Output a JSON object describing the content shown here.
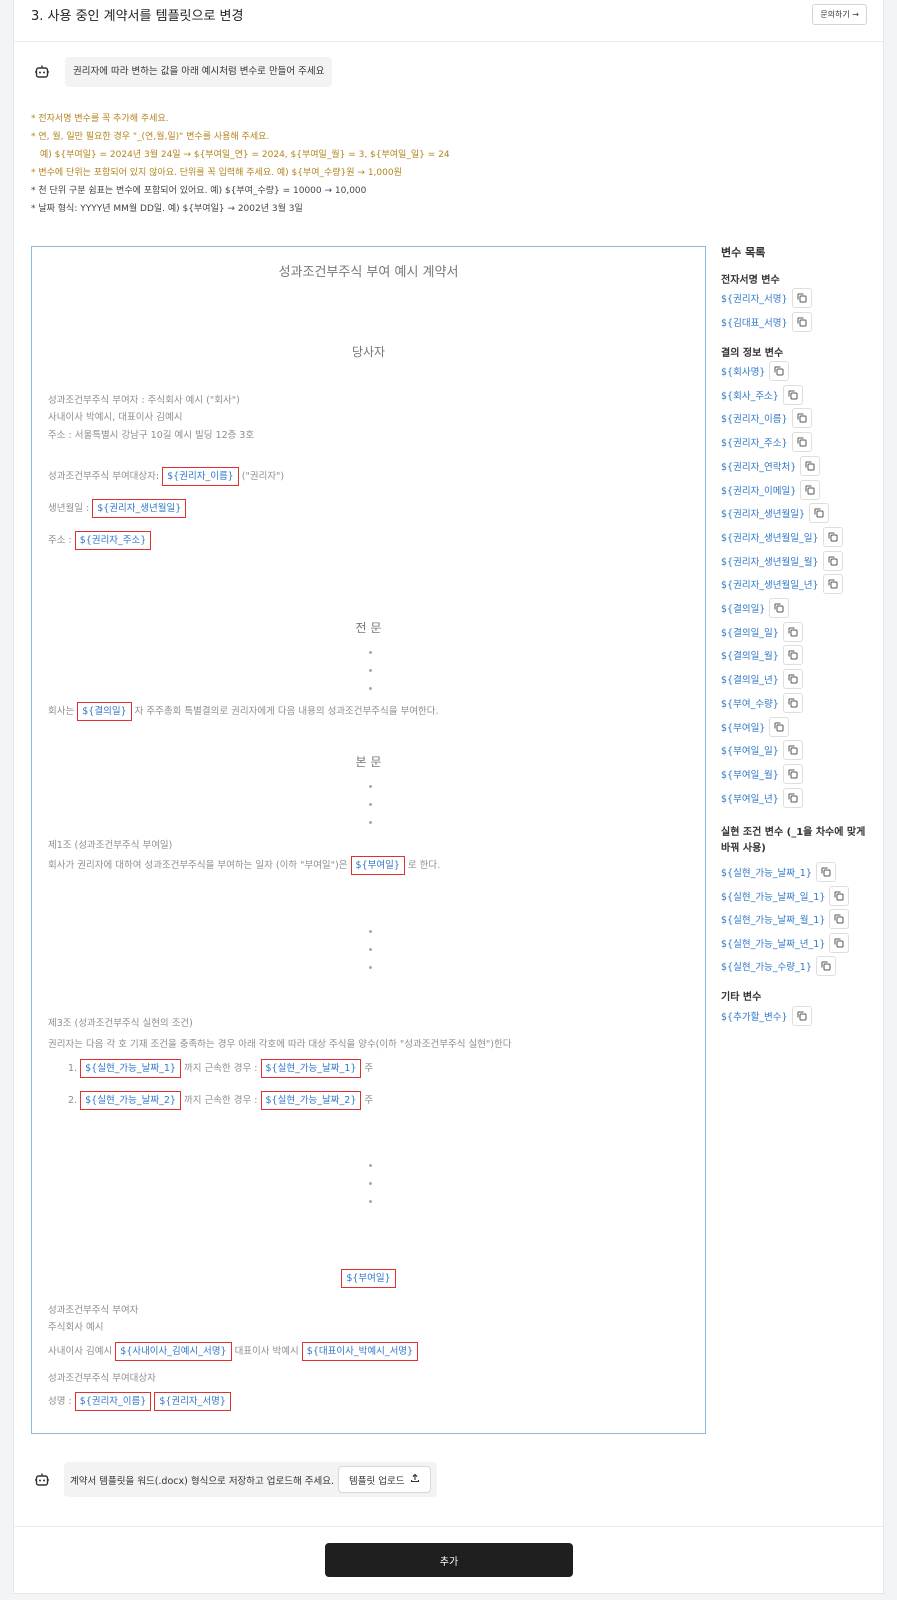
{
  "header": {
    "title": "3. 사용 중인 계약서를 템플릿으로 변경",
    "inquiry_label": "문의하기 →"
  },
  "instruction": {
    "text": "권리자에 따라 변하는 값을 아래 예시처럼 변수로 만들어 주세요"
  },
  "notes": [
    "* 전자서명 변수를 꼭 추가해 주세요.",
    "* 연, 월, 일만 필요한 경우 \"_(연,월,일)\" 변수를 사용해 주세요.",
    "예) ${부여일} = 2024년 3월 24일 → ${부여일_연} = 2024, ${부여일_월} = 3, ${부여일_일} = 24",
    "* 변수에 단위는 포함되어 있지 않아요. 단위를 꼭 입력해 주세요. 예) ${부여_수량}원 → 1,000원",
    "* 천 단위 구분 쉼표는 변수에 포함되어 있어요. 예) ${부여_수량} = 10000 → 10,000",
    "* 날짜 형식: YYYY년 MM월 DD일. 예) ${부여일} → 2002년 3월 3일"
  ],
  "doc": {
    "title": "성과조건부주식 부여 예시 계약서",
    "parties_heading": "당사자",
    "grantor_line": "성과조건부주식 부여자 : 주식회사 예시 (\"회사\")",
    "directors_line": "사내이사 박예시, 대표이사 김예시",
    "address_line": "주소 : 서울특별시 강남구 10길 예시 빌딩 12층 3호",
    "grantee_label": "성과조건부주식 부여대상자:",
    "grantee_var": "${권리자_이름}",
    "grantee_suffix": "(\"권리자\")",
    "birth_label": "생년월일 :",
    "birth_var": "${권리자_생년월일}",
    "addr_label": "주소 :",
    "addr_var": "${권리자_주소}",
    "preamble_heading": "전 문",
    "resolution_prefix": "회사는",
    "resolution_var": "${결의일}",
    "resolution_suffix": "자 주주총회 특별결의로 권리자에게 다음 내용의 성과조건부주식을 부여한다.",
    "body_heading": "본 문",
    "art1_title": "제1조 (성과조건부주식 부여일)",
    "art1_prefix": "회사가 권리자에 대하여 성과조건부주식을 부여하는 일자 (이하 \"부여일\")은",
    "art1_var": "${부여일}",
    "art1_suffix": "로 한다.",
    "art3_title": "제3조 (성과조건부주식 실현의 조건)",
    "art3_text": "권리자는 다음 각 호 기재 조건을 충족하는 경우 아래 각호에 따라 대상 주식을 양수(이하 \"성과조건부주식 실현\")한다",
    "cond1_num": "1.",
    "cond1_var1": "${실현_가능_날짜_1}",
    "cond1_mid": "까지 근속한 경우 :",
    "cond1_var2": "${실현_가능_날짜_1}",
    "cond1_suffix": "주",
    "cond2_num": "2.",
    "cond2_var1": "${실현_가능_날짜_2}",
    "cond2_mid": "까지 근속한 경우 :",
    "cond2_var2": "${실현_가능_날짜_2}",
    "cond2_suffix": "주",
    "date_var": "${부여일}",
    "sig_grantor": "성과조건부주식 부여자",
    "sig_company": "주식회사 예시",
    "sig_dir1_label": "사내이사 김예시",
    "sig_dir1_var": "${사내이사_김예시_서명}",
    "sig_dir2_label": "대표이사 박예시",
    "sig_dir2_var": "${대표이사_박예시_서명}",
    "sig_grantee": "성과조건부주식 부여대상자",
    "sig_name_label": "성명 :",
    "sig_name_var": "${권리자_이름}",
    "sig_sign_var": "${권리자_서명}"
  },
  "variables": {
    "title": "변수 목록",
    "sections": [
      {
        "title": "전자서명 변수",
        "items": [
          "${권리자_서명}",
          "${김대표_서명}"
        ]
      },
      {
        "title": "결의 정보 변수",
        "items": [
          "${회사명}",
          "${회사_주소}",
          "${권리자_이름}",
          "${권리자_주소}",
          "${권리자_연락처}",
          "${권리자_이메일}",
          "${권리자_생년월일}",
          "${권리자_생년월일_일}",
          "${권리자_생년월일_월}",
          "${권리자_생년월일_년}",
          "${결의일}",
          "${결의일_일}",
          "${결의일_월}",
          "${결의일_년}",
          "${부여_수량}",
          "${부여일}",
          "${부여일_일}",
          "${부여일_월}",
          "${부여일_년}"
        ]
      },
      {
        "title_line1": "실현 조건 변수 (_1을 차수에 맞게",
        "title_line2": "바꿔 사용)",
        "items": [
          "${실현_가능_날짜_1}",
          "${실현_가능_날짜_일_1}",
          "${실현_가능_날짜_월_1}",
          "${실현_가능_날짜_년_1}",
          "${실현_가능_수량_1}"
        ]
      },
      {
        "title": "기타 변수",
        "items": [
          "${추가할_변수}"
        ]
      }
    ]
  },
  "upload": {
    "text": "계약서 템플릿을 워드(.docx) 형식으로 저장하고 업로드해 주세요.",
    "button_label": "템플릿 업로드"
  },
  "footer": {
    "add_label": "추가"
  },
  "icons": {
    "bot": "bot-icon",
    "copy": "copy-icon",
    "upload": "upload-icon"
  },
  "colors": {
    "variable_blue": "#2f77c8",
    "highlight_red": "#e03030",
    "note_orange": "#b5841f",
    "doc_border": "#89b8e0",
    "primary_button": "#1f1f1f"
  }
}
